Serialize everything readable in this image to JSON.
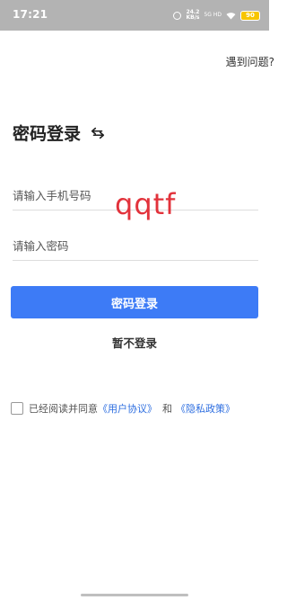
{
  "status_bar": {
    "time": "17:21",
    "net_speed_value": "24.2",
    "net_speed_unit": "KB/s",
    "net_tag_top": "5G HD",
    "net_tag_bottom": "",
    "battery": "90",
    "battery_color": "#f7c500",
    "icons": [
      "alarm-icon",
      "wifi-icon",
      "battery-icon"
    ]
  },
  "header": {
    "help_link": "遇到问题?"
  },
  "main": {
    "title": "密码登录",
    "switch_icon": "swap-arrows-icon",
    "phone_placeholder": "请输入手机号码",
    "password_placeholder": "请输入密码",
    "watermark": "qqtf",
    "login_button": "密码登录",
    "skip_link": "暂不登录"
  },
  "agreement": {
    "prefix": "已经阅读并同意",
    "user_agreement": "《用户协议》",
    "and": "和",
    "privacy_policy": "《隐私政策》"
  },
  "colors": {
    "accent": "#3d7bf6",
    "link": "#2f6fe0",
    "watermark": "#e2323b",
    "status_bar": "#b3b3b3"
  }
}
